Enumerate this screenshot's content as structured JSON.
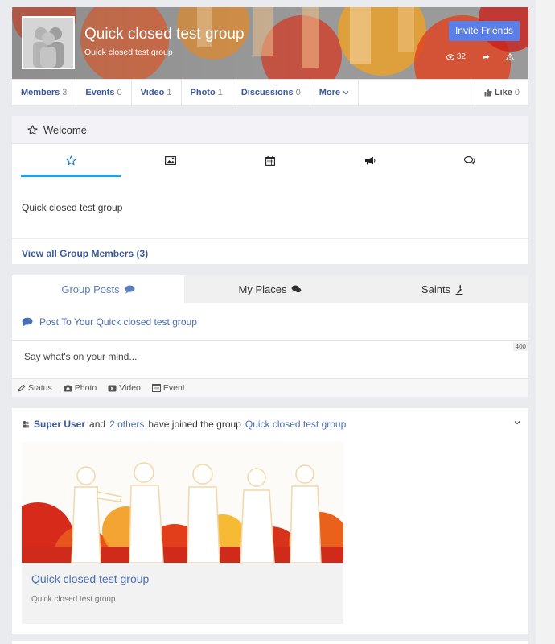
{
  "group": {
    "title": "Quick closed test group",
    "subtitle": "Quick closed test group",
    "invite_label": "Invite Friends",
    "views": "32"
  },
  "tabs": [
    {
      "label": "Members",
      "count": "3"
    },
    {
      "label": "Events",
      "count": "0"
    },
    {
      "label": "Video",
      "count": "1"
    },
    {
      "label": "Photo",
      "count": "1"
    },
    {
      "label": "Discussions",
      "count": "0"
    },
    {
      "label": "More",
      "count": ""
    }
  ],
  "like": {
    "label": "Like",
    "count": "0"
  },
  "welcome": {
    "heading": "Welcome",
    "description": "Quick closed test group",
    "view_members": "View all Group Members (3)",
    "icon_tabs": [
      "star-icon",
      "image-icon",
      "calendar-icon",
      "megaphone-icon",
      "comments-icon"
    ]
  },
  "composer": {
    "tabs": [
      "Group Posts",
      "My Places",
      "Saints"
    ],
    "post_to": "Post To Your Quick closed test group",
    "placeholder": "Say what's on your mind...",
    "char_limit": "400",
    "types": [
      "Status",
      "Photo",
      "Video",
      "Event"
    ]
  },
  "activity": {
    "actor": "Super User",
    "and": "and",
    "others": "2 others",
    "action": "have joined the group",
    "group_link": "Quick closed test group",
    "card_title": "Quick closed test group",
    "card_desc": "Quick closed test group"
  },
  "colors": {
    "accent": "#1da1f2",
    "link": "#3b5998",
    "button": "#5b7fe8"
  }
}
